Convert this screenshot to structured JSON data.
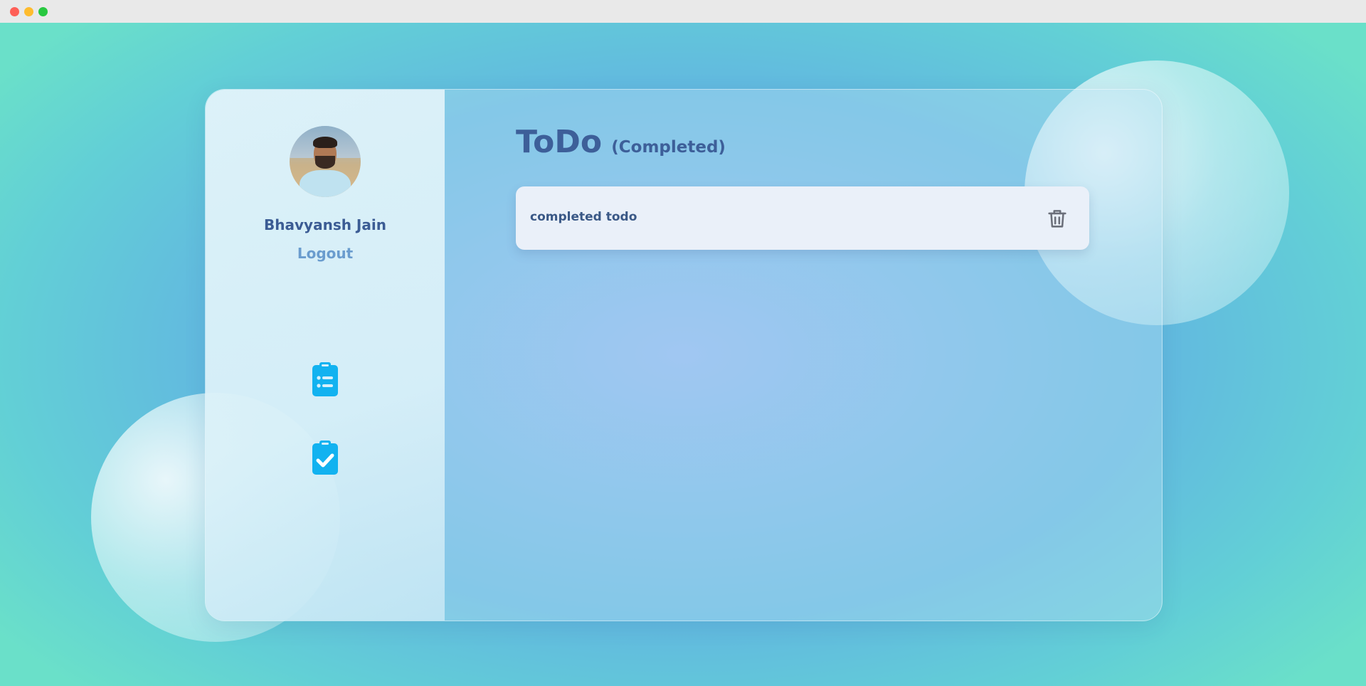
{
  "user": {
    "name": "Bhavyansh Jain",
    "logout_label": "Logout"
  },
  "nav": {
    "items": [
      {
        "icon": "clipboard-list-icon"
      },
      {
        "icon": "clipboard-check-icon"
      }
    ]
  },
  "header": {
    "title": "ToDo",
    "subtitle": "(Completed)"
  },
  "todos": [
    {
      "text": "completed todo",
      "action_icon": "trash-icon"
    }
  ],
  "colors": {
    "heading": "#3d5f99",
    "nav_icon": "#12b2f0",
    "logout": "#6a9cce",
    "card_bg": "#eaf0f9",
    "trash": "#6b6f7a"
  }
}
